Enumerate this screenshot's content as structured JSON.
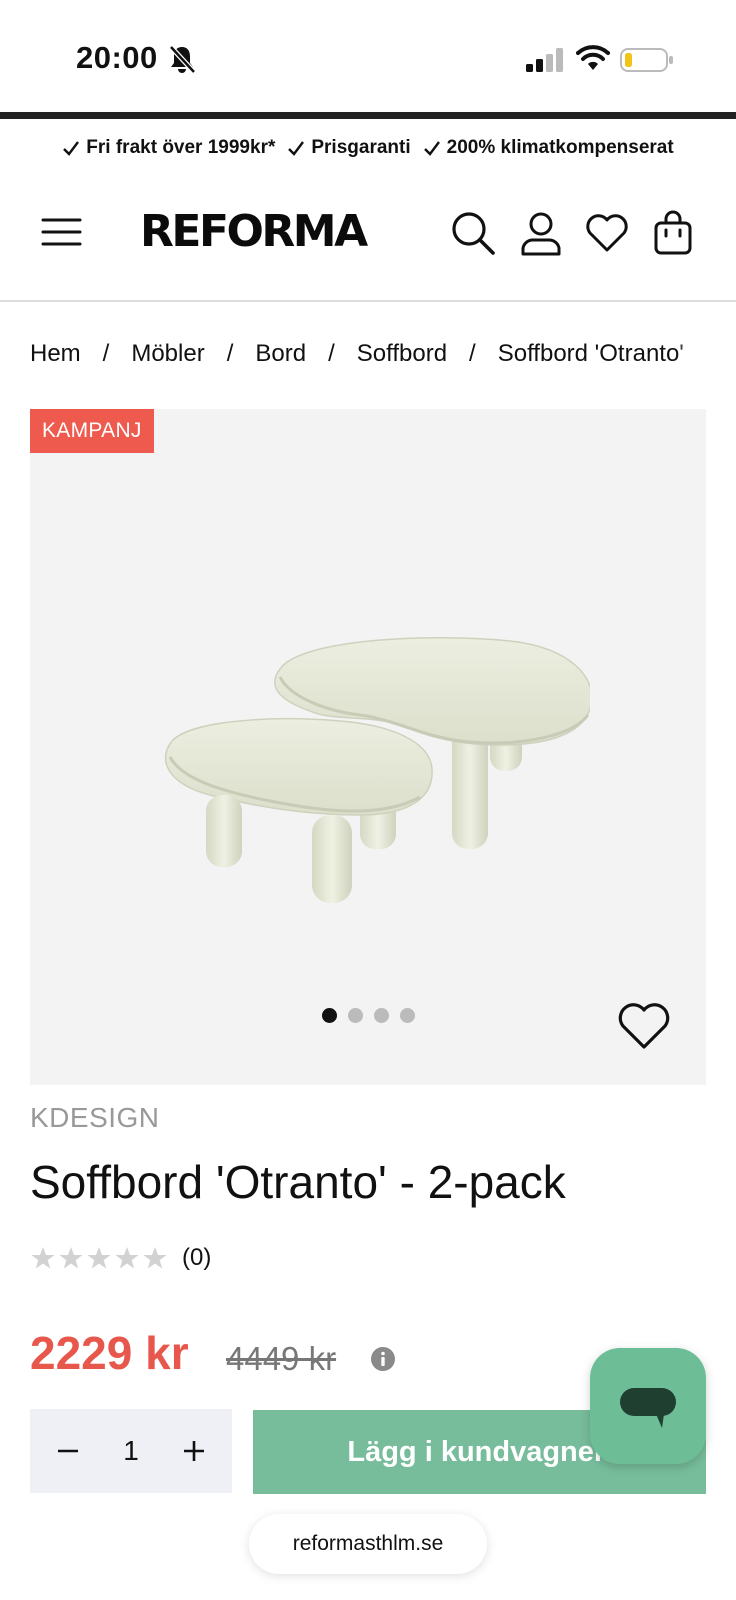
{
  "status_bar": {
    "time": "20:00"
  },
  "usp": [
    {
      "label": "Fri frakt över 1999kr*"
    },
    {
      "label": "Prisgaranti"
    },
    {
      "label": "200% klimatkompenserat"
    }
  ],
  "header": {
    "logo": "REFORMA"
  },
  "breadcrumb": [
    "Hem",
    "Möbler",
    "Bord",
    "Soffbord",
    "Soffbord 'Otranto'"
  ],
  "product": {
    "badge": "KAMPANJ",
    "brand": "KDESIGN",
    "title": "Soffbord 'Otranto' - 2-pack",
    "rating_count": "(0)",
    "rating_value": 0,
    "price_now": "2229 kr",
    "price_old": "4449 kr",
    "image_count": 4,
    "active_image": 1
  },
  "buy": {
    "quantity": "1",
    "add_to_cart_label": "Lägg i kundvagnen"
  },
  "browser": {
    "url": "reformasthlm.se"
  },
  "colors": {
    "campaign_red": "#ef5a4f",
    "price_red": "#e8574c",
    "cart_green": "#77bd9b",
    "chat_green": "#6dbd97"
  }
}
